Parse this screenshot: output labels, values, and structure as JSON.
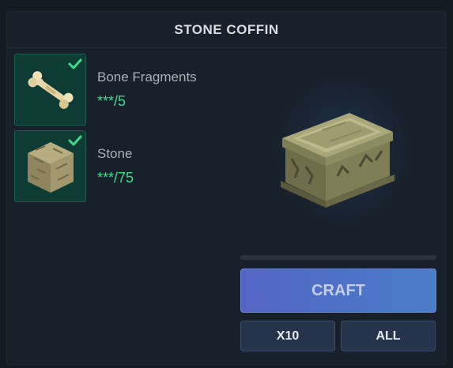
{
  "title": "STONE COFFIN",
  "ingredients": [
    {
      "name": "Bone Fragments",
      "count": "***/5",
      "icon": "bone-fragments-icon",
      "ready": true
    },
    {
      "name": "Stone",
      "count": "***/75",
      "icon": "stone-block-icon",
      "ready": true
    }
  ],
  "preview_icon": "stone-coffin-icon",
  "craft_progress": 0,
  "buttons": {
    "craft": "CRAFT",
    "x10": "X10",
    "all": "ALL"
  },
  "colors": {
    "accent": "#3fdc8c",
    "craft_button": "#5466c4",
    "slot_bg": "#0e3b34",
    "panel_bg": "#18212b"
  }
}
